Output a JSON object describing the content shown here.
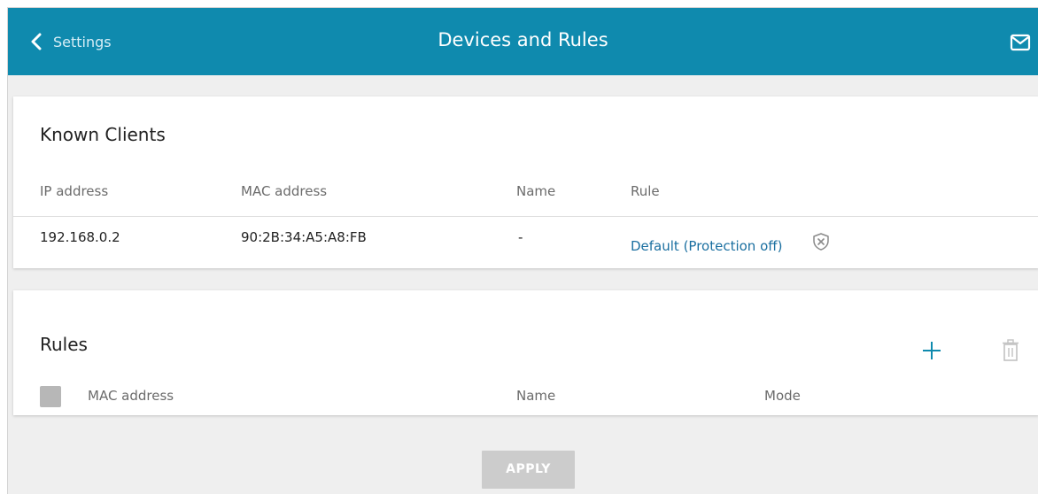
{
  "header": {
    "back_label": "Settings",
    "title": "Devices and Rules",
    "brand_color": "#0f8aae"
  },
  "known_clients": {
    "title": "Known Clients",
    "columns": [
      "IP address",
      "MAC address",
      "Name",
      "Rule"
    ],
    "rows": [
      {
        "ip": "192.168.0.2",
        "mac": "90:2B:34:A5:A8:FB",
        "name": "-",
        "rule": "Default (Protection off)"
      }
    ]
  },
  "rules": {
    "title": "Rules",
    "columns": [
      "MAC address",
      "Name",
      "Mode"
    ]
  },
  "apply_label": "APPLY",
  "icons": {
    "back": "chevron-left-icon",
    "mail": "envelope-icon",
    "shield": "shield-off-icon",
    "add": "plus-icon",
    "delete": "trash-icon"
  }
}
